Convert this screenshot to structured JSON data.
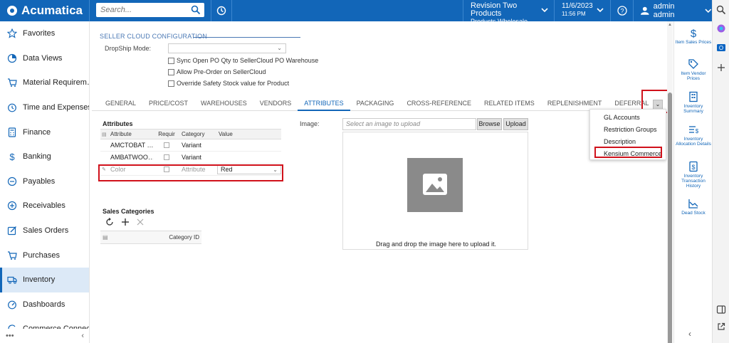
{
  "app": {
    "name": "Acumatica"
  },
  "topbar": {
    "search_placeholder": "Search...",
    "company_line1": "Revision Two Products",
    "company_line2": "Products Wholesale",
    "date": "11/6/2023",
    "time": "11:56 PM",
    "user": "admin admin"
  },
  "nav": {
    "items": [
      {
        "label": "Favorites",
        "icon": "star-icon"
      },
      {
        "label": "Data Views",
        "icon": "pie-chart-icon"
      },
      {
        "label": "Material Requirem…",
        "icon": "cart-icon"
      },
      {
        "label": "Time and Expenses",
        "icon": "clock-icon"
      },
      {
        "label": "Finance",
        "icon": "calculator-icon"
      },
      {
        "label": "Banking",
        "icon": "dollar-icon"
      },
      {
        "label": "Payables",
        "icon": "minus-circle-icon"
      },
      {
        "label": "Receivables",
        "icon": "plus-circle-icon"
      },
      {
        "label": "Sales Orders",
        "icon": "edit-icon"
      },
      {
        "label": "Purchases",
        "icon": "cart-icon"
      },
      {
        "label": "Inventory",
        "icon": "truck-icon"
      },
      {
        "label": "Dashboards",
        "icon": "gauge-icon"
      },
      {
        "label": "Commerce Connec…",
        "icon": "sync-icon"
      }
    ],
    "more": "•••",
    "collapse": "‹"
  },
  "config": {
    "section_title": "SELLER CLOUD CONFIGURATION",
    "dropship_label": "DropShip Mode:",
    "dropship_value": "",
    "checkboxes": [
      "Sync Open PO Qty to SellerCloud PO Warehouse",
      "Allow Pre-Order on SellerCloud",
      "Override Safety Stock value for Product"
    ]
  },
  "tabs": [
    "GENERAL",
    "PRICE/COST",
    "WAREHOUSES",
    "VENDORS",
    "ATTRIBUTES",
    "PACKAGING",
    "CROSS-REFERENCE",
    "RELATED ITEMS",
    "REPLENISHMENT",
    "DEFERRAL"
  ],
  "active_tab": "ATTRIBUTES",
  "attributes": {
    "title": "Attributes",
    "columns": [
      "Attribute",
      "Requir",
      "Category",
      "Value"
    ],
    "rows": [
      {
        "attribute": "AMCTOBAT …",
        "category": "Variant",
        "value": ""
      },
      {
        "attribute": "AMBATWOO…",
        "category": "Variant",
        "value": ""
      },
      {
        "attribute": "Color",
        "category": "Attribute",
        "value": "Red"
      }
    ]
  },
  "sales_categories": {
    "title": "Sales Categories",
    "column": "Category ID"
  },
  "image": {
    "label": "Image:",
    "placeholder": "Select an image to upload",
    "browse": "Browse",
    "upload": "Upload",
    "drop_text": "Drag and drop the image here to upload it."
  },
  "dropdown_menu": {
    "items": [
      "GL Accounts",
      "Restriction Groups",
      "Description",
      "Kensium Commerce"
    ]
  },
  "right_panel": {
    "items": [
      {
        "label": "Item Sales Prices",
        "icon": "dollar-icon"
      },
      {
        "label": "Item Vendor Prices",
        "icon": "tag-icon"
      },
      {
        "label": "Inventory Summary",
        "icon": "building-icon"
      },
      {
        "label": "Inventory Allocation Details",
        "icon": "list-dollar-icon"
      },
      {
        "label": "Inventory Transaction History",
        "icon": "document-dollar-icon"
      },
      {
        "label": "Dead Stock",
        "icon": "line-chart-icon"
      }
    ]
  },
  "colors": {
    "brand": "#1266b8",
    "highlight": "#d0111b"
  }
}
